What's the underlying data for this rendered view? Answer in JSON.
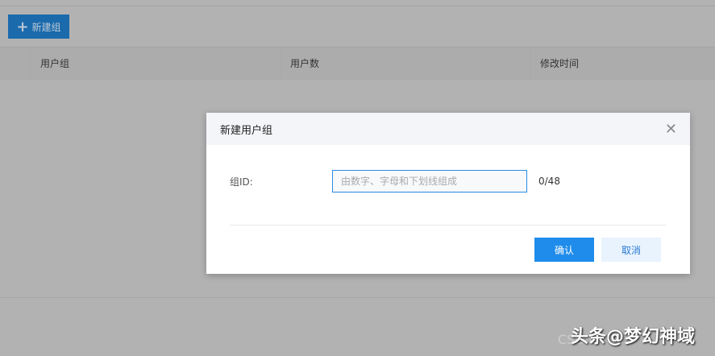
{
  "toolbar": {
    "new_group_label": "新建组"
  },
  "table": {
    "headers": [
      "用户组",
      "用户数",
      "修改时间"
    ]
  },
  "dialog": {
    "title": "新建用户组",
    "field_label": "组ID:",
    "input_value": "",
    "input_placeholder": "由数字、字母和下划线组成",
    "char_count": "0/48",
    "confirm_label": "确认",
    "cancel_label": "取消"
  },
  "watermark": {
    "text": "头条@梦幻神域",
    "sub_text": "CSDN"
  }
}
